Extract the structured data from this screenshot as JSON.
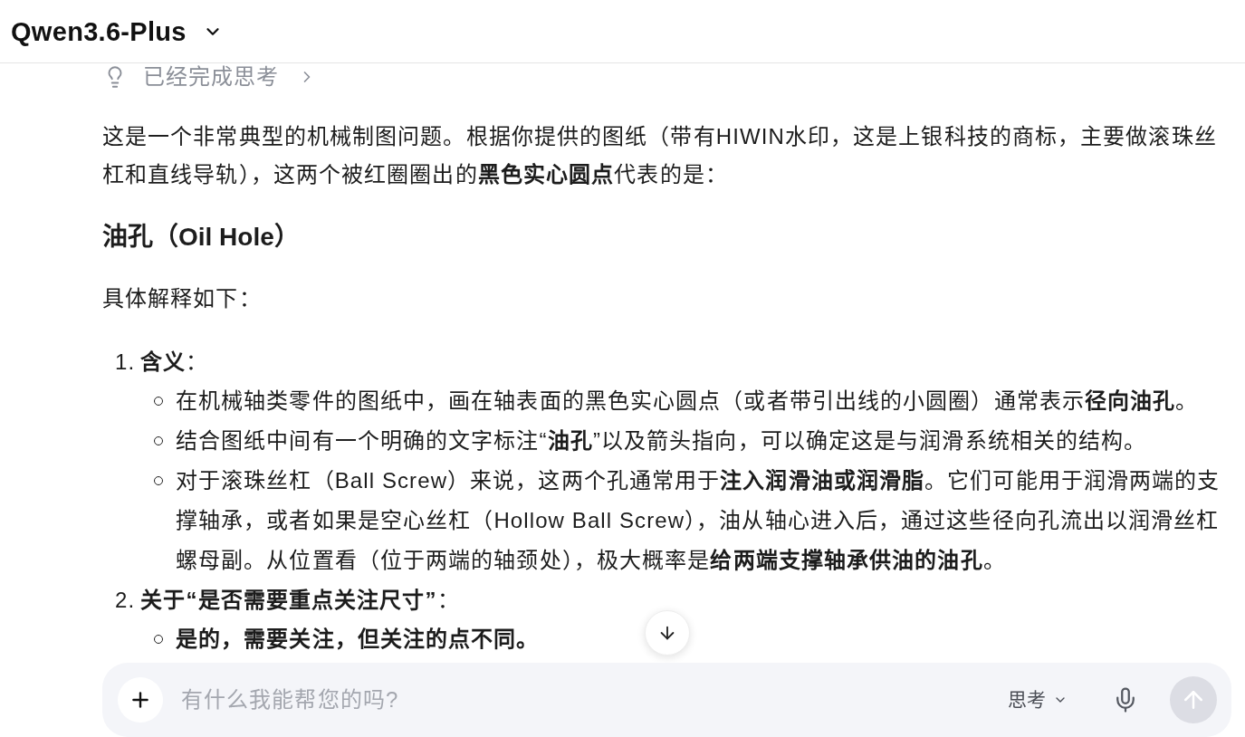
{
  "header": {
    "model_name": "Qwen3.6-Plus"
  },
  "thinking": {
    "label": "已经完成思考",
    "expanded": false
  },
  "message": {
    "intro": "这是一个非常典型的机械制图问题。根据你提供的图纸（带有HIWIN水印，这是上银科技的商标，主要做滚珠丝杠和直线导轨），这两个被红圈圈出的**黑色实心圆点**代表的是：",
    "heading": "油孔（Oil Hole）",
    "lead": "具体解释如下：",
    "list": [
      {
        "number": "1.",
        "title": "**含义**：",
        "bullets": [
          {
            "text": "在机械轴类零件的图纸中，画在轴表面的黑色实心圆点（或者带引出线的小圆圈）通常表示**径向油孔**。",
            "bold": false
          },
          {
            "text": "结合图纸中间有一个明确的文字标注“**油孔**”以及箭头指向，可以确定这是与润滑系统相关的结构。",
            "bold": false
          },
          {
            "text": "对于滚珠丝杠（Ball Screw）来说，这两个孔通常用于**注入润滑油或润滑脂**。它们可能用于润滑两端的支撑轴承，或者如果是空心丝杠（Hollow Ball Screw），油从轴心进入后，通过这些径向孔流出以润滑丝杠螺母副。从位置看（位于两端的轴颈处），极大概率是**给两端支撑轴承供油的油孔**。",
            "bold": false
          }
        ]
      },
      {
        "number": "2.",
        "title": "**关于“是否需要重点关注尺寸”**：",
        "bullets": [
          {
            "text": "是的，需要关注，但关注的点不同。",
            "bold": true
          }
        ]
      }
    ]
  },
  "composer": {
    "placeholder": "有什么我能帮您的吗?",
    "mode_label": "思考",
    "send_button": {
      "disabled": true
    }
  }
}
